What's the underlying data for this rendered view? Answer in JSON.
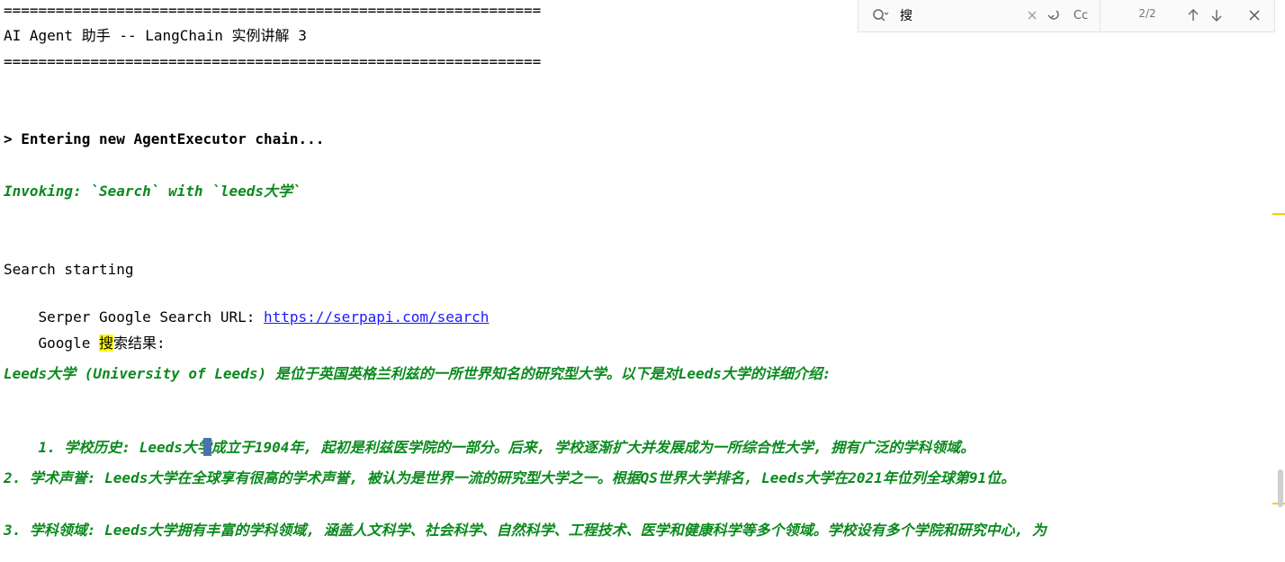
{
  "console": {
    "separator_top": "==============================================================",
    "title": "AI Agent 助手 -- LangChain 实例讲解 3",
    "separator_bottom": "==============================================================",
    "entering": "> Entering new AgentExecutor chain...",
    "invoking": "Invoking: `Search` with `leeds大学`",
    "search_starting": "Search starting",
    "serper_prefix": "Serper Google Search URL: ",
    "serper_url": "https://serpapi.com/search",
    "google_prefix": "Google ",
    "google_highlight": "搜",
    "google_suffix": "索结果:",
    "intro": "Leeds大学 (University of Leeds) 是位于英国英格兰利兹的一所世界知名的研究型大学。以下是对Leeds大学的详细介绍:",
    "item1_a": "1. 学校历史: Leeds大学",
    "item1_b": "成立于1904年, 起初是利兹医学院的一部分。后来, 学校逐渐扩大并发展成为一所综合性大学, 拥有广泛的学科领域。",
    "item2": "2. 学术声誉: Leeds大学在全球享有很高的学术声誉, 被认为是世界一流的研究型大学之一。根据QS世界大学排名, Leeds大学在2021年位列全球第91位。",
    "item3": "3. 学科领域: Leeds大学拥有丰富的学科领域, 涵盖人文科学、社会科学、自然科学、工程技术、医学和健康科学等多个领域。学校设有多个学院和研究中心, 为"
  },
  "findbar": {
    "query": "搜",
    "match_count": "2/2",
    "icons": {
      "search": "search-icon",
      "clear": "close-icon",
      "wrap": "newline-icon",
      "case": "match-case-icon",
      "prev": "arrow-up-icon",
      "next": "arrow-down-icon",
      "close": "close-icon"
    },
    "case_label": "Cc"
  },
  "colors": {
    "green": "#0b8a1e",
    "link": "#1a1aff",
    "highlight": "#ffff00",
    "marker": "#f0d000"
  }
}
